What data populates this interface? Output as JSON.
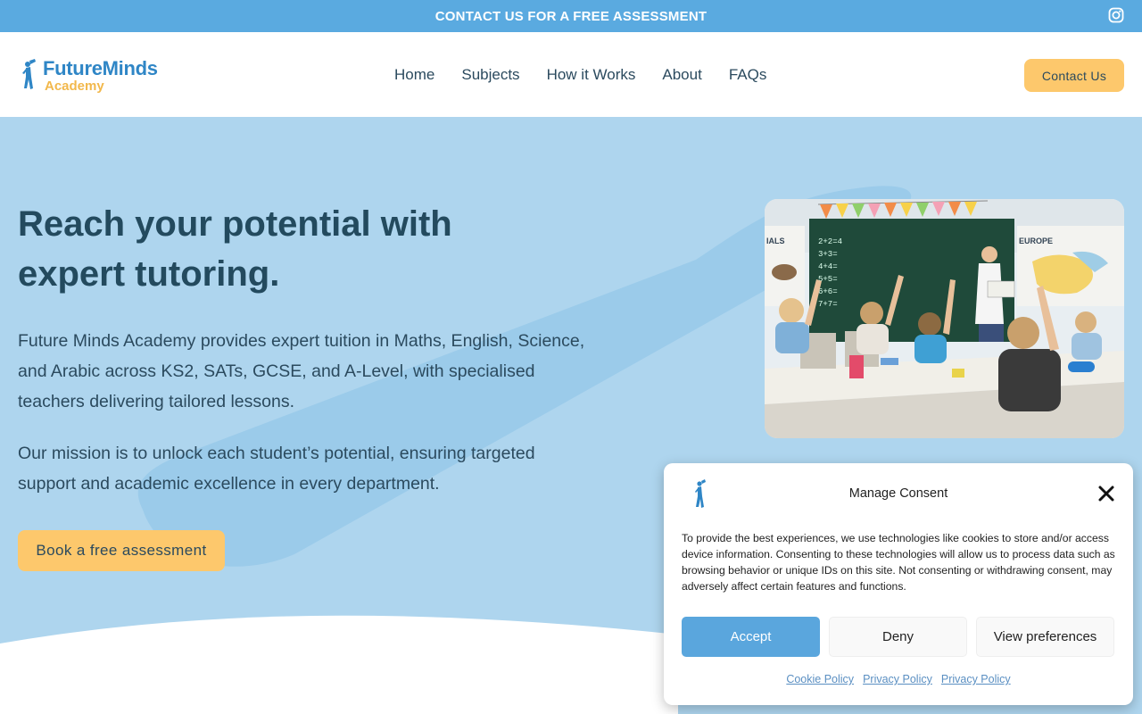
{
  "topbar": {
    "cta": "CONTACT US FOR A FREE ASSESSMENT",
    "social_icon": "instagram-icon"
  },
  "header": {
    "logo": {
      "line1": "FutureMinds",
      "line2": "Academy"
    },
    "nav": [
      {
        "label": "Home"
      },
      {
        "label": "Subjects"
      },
      {
        "label": "How it Works"
      },
      {
        "label": "About"
      },
      {
        "label": "FAQs"
      }
    ],
    "contact_button": "Contact Us"
  },
  "hero": {
    "title": "Reach your potential with expert tutoring.",
    "paragraph1": "Future Minds Academy provides expert tuition in Maths, English, Science, and Arabic across KS2, SATs, GCSE, and A-Level, with specialised teachers delivering tailored lessons.",
    "paragraph2": "Our mission is to unlock each student’s potential, ensuring targeted support and academic excellence in every department.",
    "button": "Book a free assessment",
    "image": {
      "subject": "classroom-with-students-raising-hands",
      "board_labels": [
        "IALS",
        "EUROPE"
      ],
      "board_equations": [
        "2+2=4",
        "3+3=",
        "4+4=",
        "5+5=",
        "6+6=",
        "7+7="
      ]
    }
  },
  "consent": {
    "title": "Manage Consent",
    "text": "To provide the best experiences, we use technologies like cookies to store and/or access device information. Consenting to these technologies will allow us to process data such as browsing behavior or unique IDs on this site. Not consenting or withdrawing consent, may adversely affect certain features and functions.",
    "buttons": {
      "accept": "Accept",
      "deny": "Deny",
      "preferences": "View preferences"
    },
    "links": [
      "Cookie Policy",
      "Privacy Policy",
      "Privacy Policy"
    ]
  },
  "colors": {
    "topbar": "#5aaae0",
    "hero_bg": "#aed5ee",
    "accent_yellow": "#fdc86c",
    "logo_blue": "#2f86c6",
    "logo_yellow": "#f2b84b",
    "accept_button": "#5aa6dd",
    "heading": "#234a5e"
  }
}
